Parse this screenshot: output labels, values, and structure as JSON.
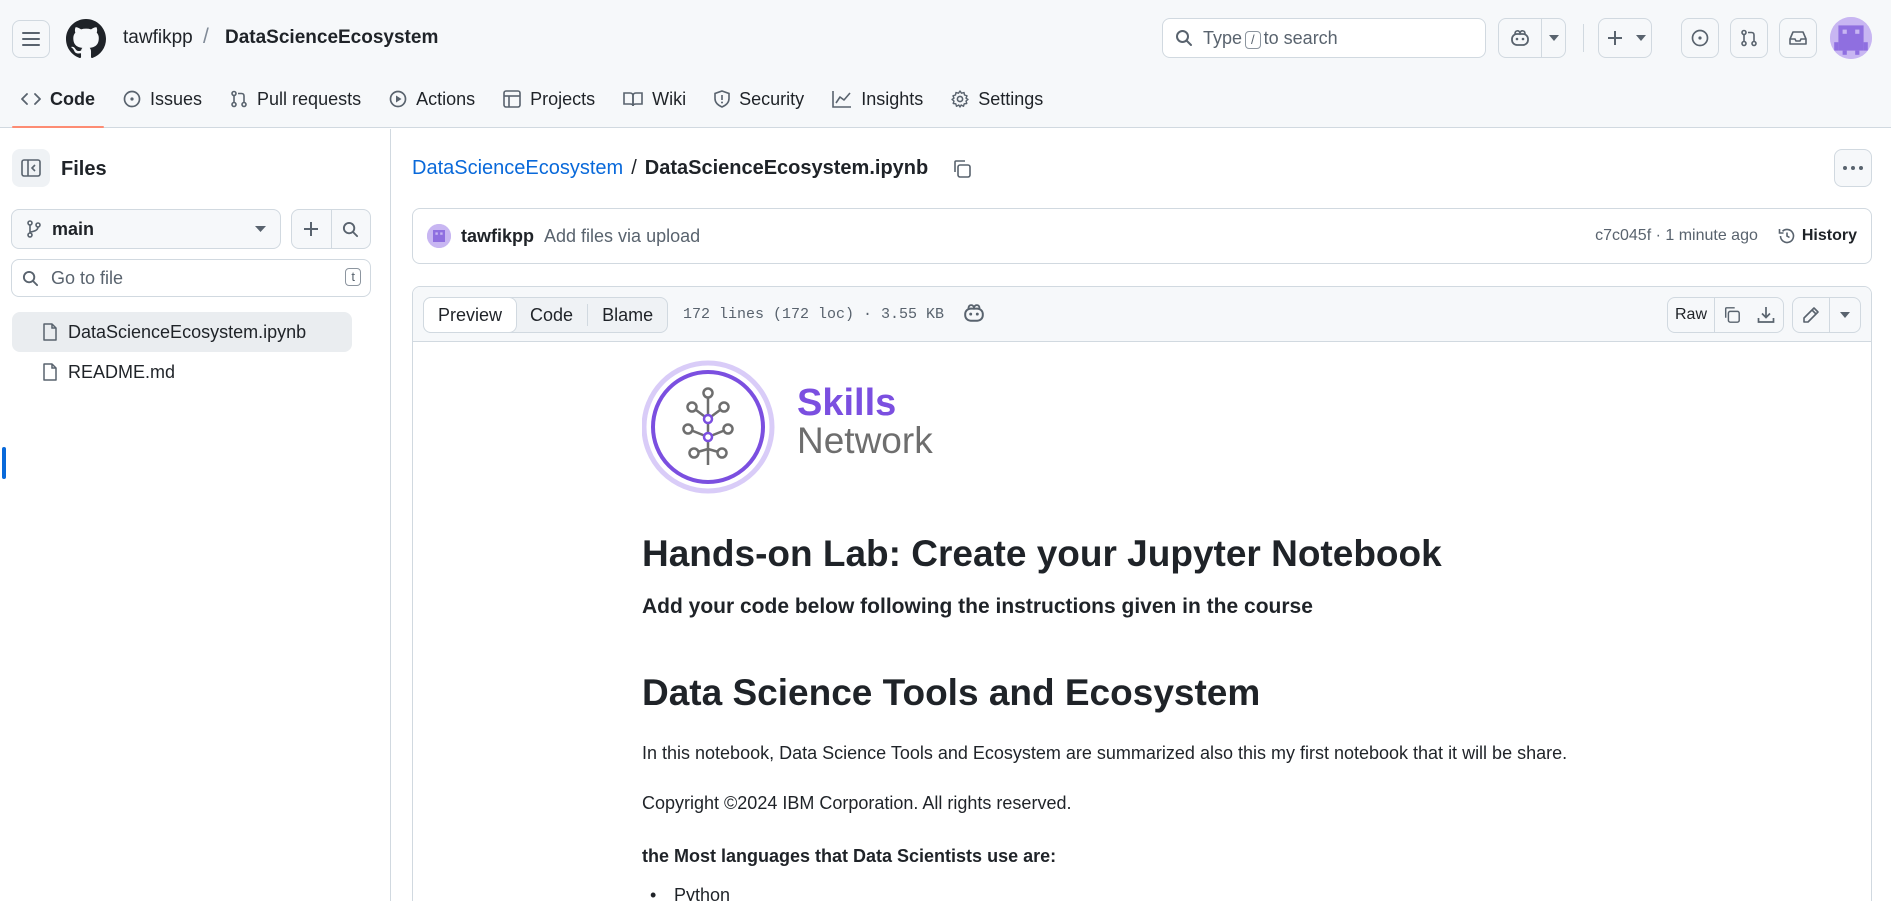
{
  "header": {
    "owner": "tawfikpp",
    "separator": "/",
    "repo": "DataScienceEcosystem",
    "search_pre": "Type",
    "search_key": "/",
    "search_post": "to search"
  },
  "nav": [
    {
      "label": "Code",
      "icon": "code-icon",
      "active": true
    },
    {
      "label": "Issues",
      "icon": "issue-icon"
    },
    {
      "label": "Pull requests",
      "icon": "pull-request-icon"
    },
    {
      "label": "Actions",
      "icon": "play-icon"
    },
    {
      "label": "Projects",
      "icon": "table-icon"
    },
    {
      "label": "Wiki",
      "icon": "book-icon"
    },
    {
      "label": "Security",
      "icon": "shield-icon"
    },
    {
      "label": "Insights",
      "icon": "graph-icon"
    },
    {
      "label": "Settings",
      "icon": "gear-icon"
    }
  ],
  "sidebar": {
    "title": "Files",
    "branch": "main",
    "goto_placeholder": "Go to file",
    "goto_key": "t",
    "files": [
      {
        "name": "DataScienceEcosystem.ipynb",
        "selected": true
      },
      {
        "name": "README.md",
        "selected": false
      }
    ]
  },
  "file": {
    "repo_link": "DataScienceEcosystem",
    "sep": "/",
    "name": "DataScienceEcosystem.ipynb"
  },
  "commit": {
    "user": "tawfikpp",
    "message": "Add files via upload",
    "meta": "c7c045f · 1 minute ago",
    "history": "History"
  },
  "viewer": {
    "tabs": [
      "Preview",
      "Code",
      "Blame"
    ],
    "info": "172 lines (172 loc) · 3.55 KB",
    "raw": "Raw"
  },
  "notebook": {
    "logo_line1": "Skills",
    "logo_line2": "Network",
    "h1": "Hands-on Lab: Create your Jupyter Notebook",
    "h3": "Add your code below following the instructions given in the course",
    "h1b": "Data Science Tools and Ecosystem",
    "p1": "In this notebook, Data Science Tools and Ecosystem are summarized also this my first notebook that it will be share.",
    "p2": "Copyright ©2024 IBM Corporation. All rights reserved.",
    "p3": "the Most languages that Data Scientists use are:",
    "li1": "Python"
  },
  "colors": {
    "accent": "#0969da",
    "active_tab": "#fd8c73",
    "logo_purple": "#7b4fe0",
    "logo_gray": "#6e6e6e"
  }
}
